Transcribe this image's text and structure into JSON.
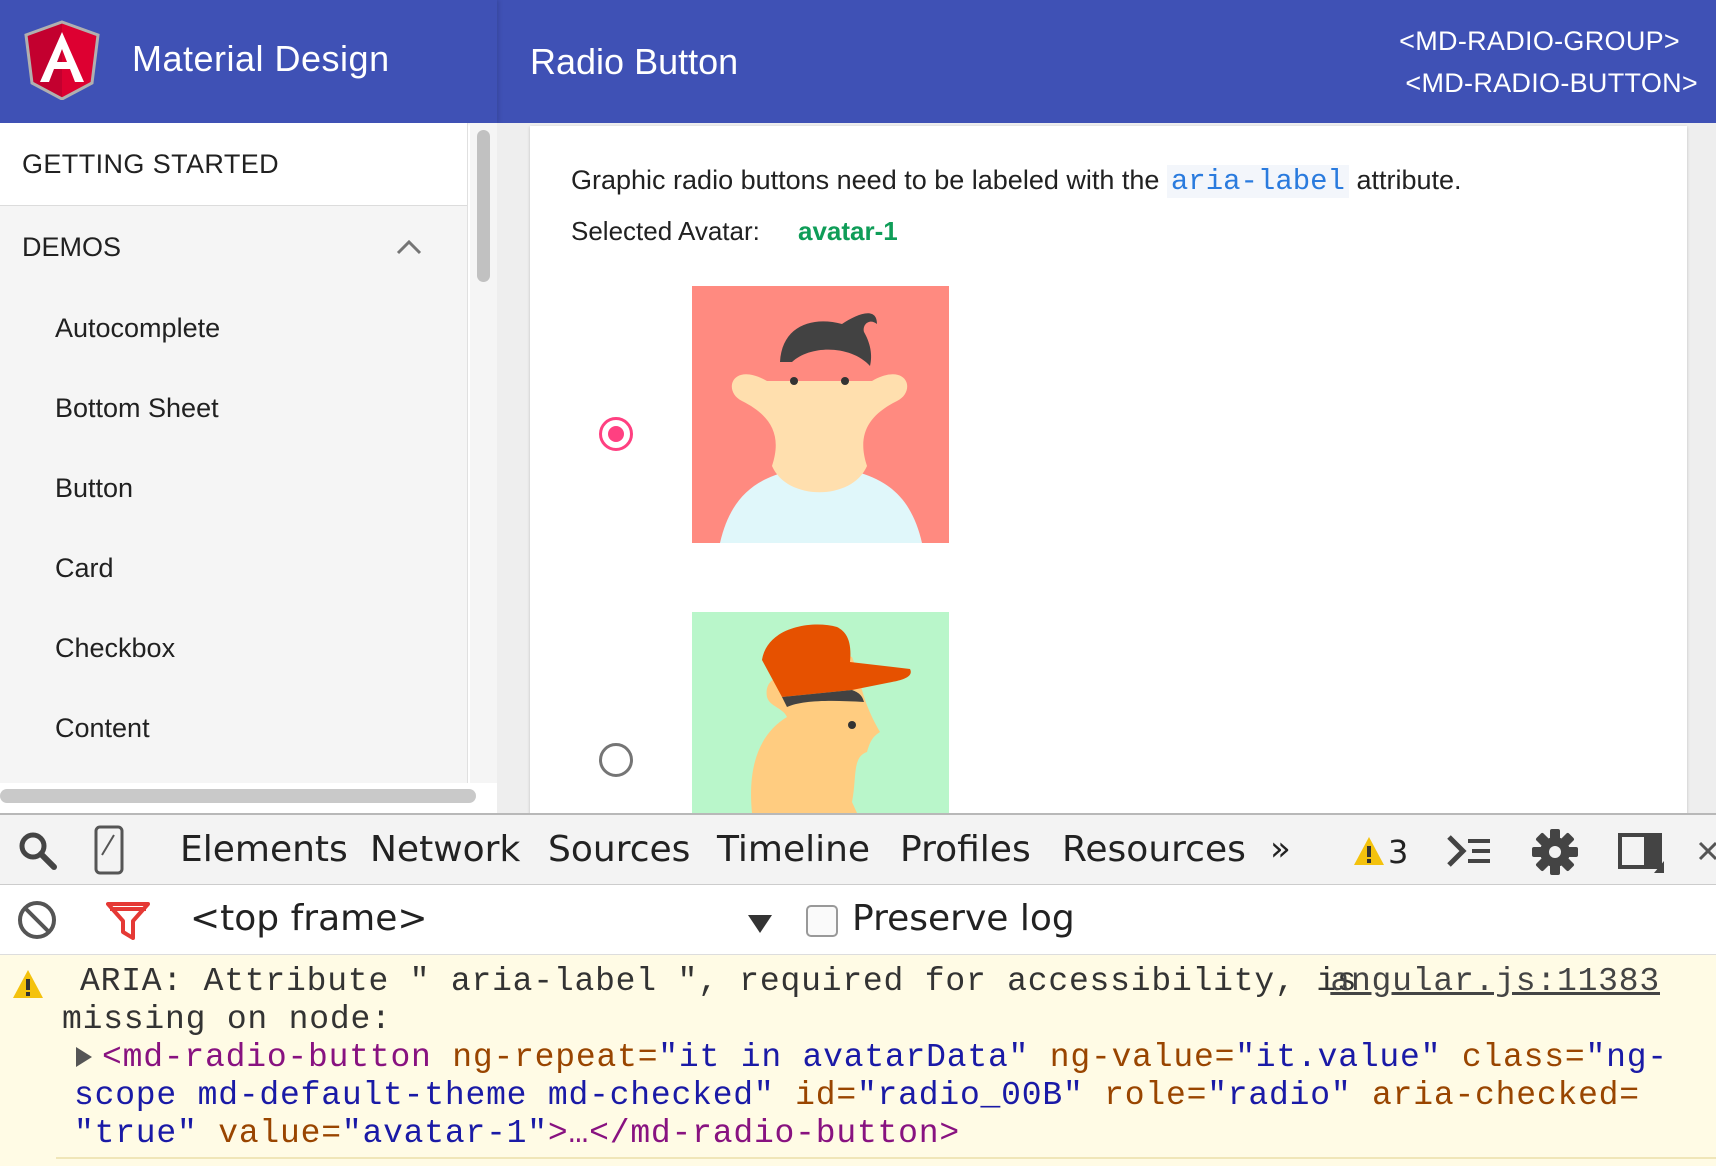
{
  "header": {
    "brand_title": "Material Design",
    "page_title": "Radio Button",
    "directives": [
      "<MD-RADIO-GROUP>",
      "<MD-RADIO-BUTTON>"
    ],
    "accent_color": "#3f51b5"
  },
  "sidebar": {
    "top_item": "GETTING STARTED",
    "section": "DEMOS",
    "items": [
      "Autocomplete",
      "Bottom Sheet",
      "Button",
      "Card",
      "Checkbox",
      "Content"
    ]
  },
  "content": {
    "description_before": "Graphic radio buttons need to be labeled with the ",
    "description_code": "aria-label",
    "description_after": " attribute.",
    "selected_label": "Selected Avatar:",
    "selected_value": "avatar-1",
    "radios": [
      {
        "checked": true,
        "avatar_bg": "#ff8a80"
      },
      {
        "checked": false,
        "avatar_bg": "#b9f6ca"
      }
    ]
  },
  "devtools": {
    "tabs": [
      "Elements",
      "Network",
      "Sources",
      "Timeline",
      "Profiles",
      "Resources"
    ],
    "more": "»",
    "warning_count": "3",
    "frame": "<top frame>",
    "preserve_log": "Preserve log",
    "console": {
      "line1": "ARIA: Attribute \" aria-label \", required for accessibility, is",
      "source": "angular.js:11383",
      "line2": "missing on node:",
      "node_tag_open": "<md-radio-button",
      "attr1_name": " ng-repeat=",
      "attr1_val": "\"it in avatarData\"",
      "attr2_name": " ng-value=",
      "attr2_val": "\"it.value\"",
      "attr3_name": " class=",
      "attr3_val_a": "\"ng-",
      "attr3_val_b": "scope md-default-theme md-checked\"",
      "attr4_name": " id=",
      "attr4_val": "\"radio_00B\"",
      "attr5_name": " role=",
      "attr5_val": "\"radio\"",
      "attr6_name": " aria-checked=",
      "attr6_val": "\"true\"",
      "attr7_name": " value=",
      "attr7_val": "\"avatar-1\"",
      "node_tail": ">…</md-radio-button>"
    }
  }
}
